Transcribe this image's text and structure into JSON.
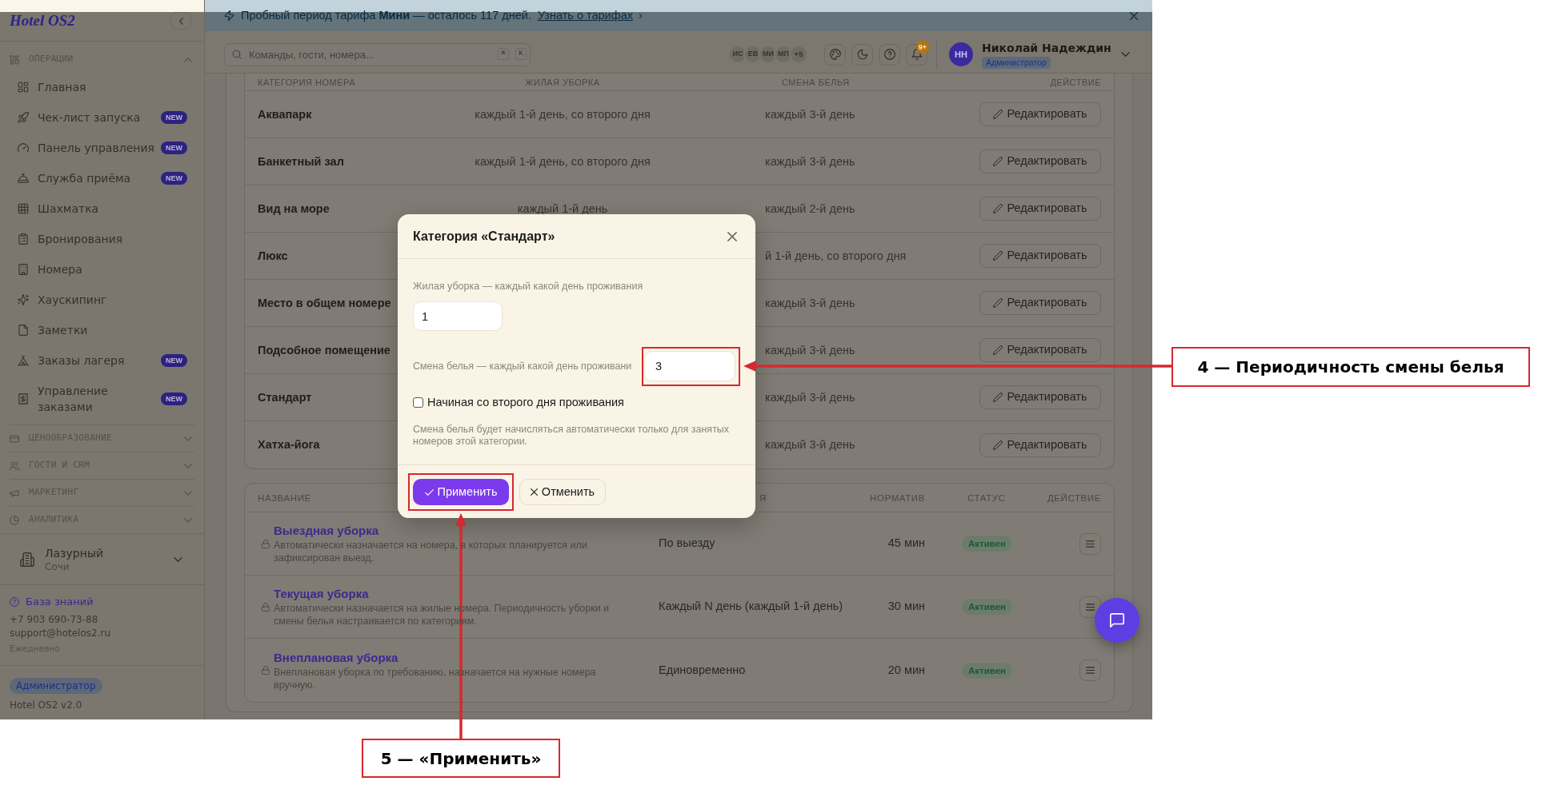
{
  "sidebar": {
    "logo": "Hotel OS2",
    "sections": [
      {
        "title": "ОПЕРАЦИИ",
        "expanded": true,
        "items": [
          {
            "label": "Главная"
          },
          {
            "label": "Чек-лист запуска",
            "badge": "NEW"
          },
          {
            "label": "Панель управления",
            "badge": "NEW"
          },
          {
            "label": "Служба приёма",
            "badge": "NEW"
          },
          {
            "label": "Шахматка"
          },
          {
            "label": "Бронирования"
          },
          {
            "label": "Номера"
          },
          {
            "label": "Хаускипинг"
          },
          {
            "label": "Заметки"
          },
          {
            "label": "Заказы лагеря",
            "badge": "NEW"
          },
          {
            "label": "Управление заказами",
            "badge": "NEW"
          }
        ]
      },
      {
        "title": "ЦЕНООБРАЗОВАНИЕ",
        "expanded": false
      },
      {
        "title": "ГОСТИ И CRM",
        "expanded": false
      },
      {
        "title": "МАРКЕТИНГ",
        "expanded": false
      },
      {
        "title": "АНАЛИТИКА",
        "expanded": false
      }
    ],
    "hotel": {
      "name": "Лазурный",
      "city": "Сочи"
    },
    "support": {
      "link": "База знаний",
      "phone": "+7 903 690-73-88",
      "email": "support@hotelos2.ru",
      "hours": "Ежедневно"
    },
    "role": "Администратор",
    "version": "Hotel OS2 v2.0"
  },
  "banner": {
    "text": "Пробный период тарифа **Мини** — осталось 117 дней.",
    "link": "Узнать о тарифах",
    "link_arrow": "›"
  },
  "header": {
    "search": {
      "placeholder": "Команды, гости, номера...",
      "keys": [
        "⌘",
        "K"
      ]
    },
    "avatars": [
      "ИС",
      "ЕВ",
      "МИ",
      "МП"
    ],
    "avatars_more": "+5",
    "notifications": "9+",
    "user": {
      "initials": "НН",
      "name": "Николай Надеждин",
      "role": "Администратор"
    }
  },
  "categories_table": {
    "columns": [
      "КАТЕГОРИЯ НОМЕРА",
      "ЖИЛАЯ УБОРКА",
      "СМЕНА БЕЛЬЯ",
      "ДЕЙСТВИЕ"
    ],
    "rows": [
      {
        "category": "Аквапарк",
        "room_cleaning": "каждый 1-й день, со второго дня",
        "linen_change": "каждый 3-й день",
        "action": "Редактировать"
      },
      {
        "category": "Банкетный зал",
        "room_cleaning": "каждый 1-й день, со второго дня",
        "linen_change": "каждый 3-й день",
        "action": "Редактировать"
      },
      {
        "category": "Вид на море",
        "room_cleaning": "каждый 1-й день",
        "linen_change": "каждый 2-й день",
        "action": "Редактировать"
      },
      {
        "category": "Люкс",
        "linen_change": "й 1-й день, со второго дня",
        "action": "Редактировать"
      },
      {
        "category": "Место в общем номере",
        "linen_change": "каждый 3-й день",
        "action": "Редактировать"
      },
      {
        "category": "Подсобное помещение",
        "linen_change": "каждый 3-й день",
        "action": "Редактировать"
      },
      {
        "category": "Стандарт",
        "linen_change": "каждый 3-й день",
        "action": "Редактировать"
      },
      {
        "category": "Хатха-йога",
        "linen_change": "каждый 3-й день",
        "action": "Редактировать"
      }
    ]
  },
  "cleaning_types_table": {
    "columns": [
      "НАЗВАНИЕ",
      "Я",
      "НОРМАТИВ",
      "СТАТУС",
      "ДЕЙСТВИЕ"
    ],
    "rows": [
      {
        "name": "Выездная уборка",
        "locked": true,
        "description": "Автоматически назначается на номера, в которых планируется или зафиксирован выезд.",
        "schedule": "По выезду",
        "duration": "45 мин",
        "status": "Активен"
      },
      {
        "name": "Текущая уборка",
        "locked": true,
        "description": "Автоматически назначается на жилые номера. Периодичность уборки и смены белья настраивается по категориям.",
        "schedule": "Каждый N день (каждый 1-й день)",
        "duration": "30 мин",
        "status": "Активен"
      },
      {
        "name": "Внеплановая уборка",
        "locked": true,
        "description": "Внеплановая уборка по требованию, назначается на нужные номера вручную.",
        "schedule": "Единовременно",
        "duration": "20 мин",
        "status": "Активен"
      }
    ]
  },
  "modal": {
    "title": "Категория «Стандарт»",
    "fields": [
      {
        "kind": "stacked",
        "label": "Жилая уборка — каждый какой день проживания",
        "value": "1"
      },
      {
        "kind": "inline",
        "label": "Смена белья — каждый какой день проживани",
        "value": "3"
      }
    ],
    "checkbox": {
      "label": "Начиная со второго дня проживания",
      "checked": false
    },
    "hint": "Смена белья будет начисляться автоматически только для занятых номеров этой категории.",
    "buttons": [
      {
        "kind": "primary",
        "label": "Применить"
      },
      {
        "kind": "secondary",
        "label": "Отменить"
      }
    ]
  },
  "annotations": [
    {
      "kind": "side",
      "label": "4 — Периодичность смены белья"
    },
    {
      "kind": "below",
      "label": "5 — «Применить»"
    }
  ]
}
